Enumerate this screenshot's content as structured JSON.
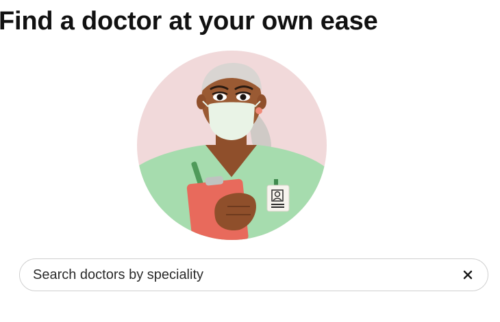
{
  "header": {
    "title": "Find a doctor at your own ease"
  },
  "illustration": {
    "subject": "doctor-avatar",
    "colors": {
      "background": "#f1d9da",
      "scrubs": "#a6dcae",
      "clipboard": "#e86a5c",
      "skin": "#9a5a33",
      "hair": "#d9d5d2",
      "mask": "#e9f3e6"
    }
  },
  "search": {
    "placeholder": "Search doctors by speciality",
    "value": "",
    "clear_icon": "close-icon"
  }
}
